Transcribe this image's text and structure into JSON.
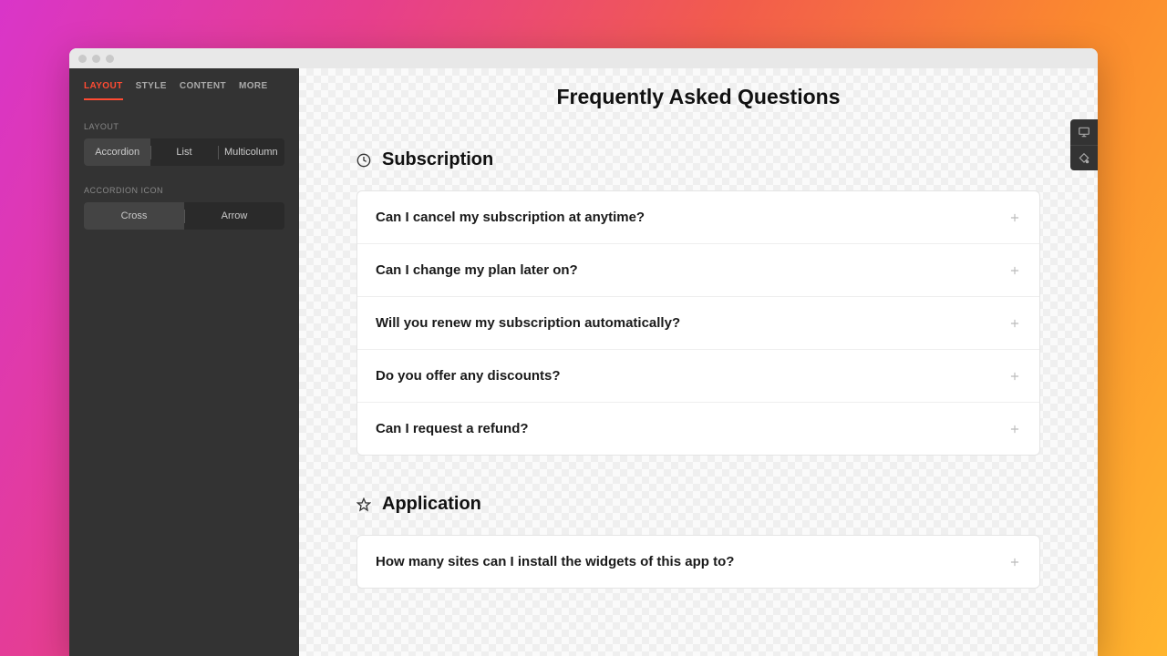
{
  "sidebar": {
    "tabs": [
      {
        "label": "LAYOUT",
        "active": true
      },
      {
        "label": "STYLE",
        "active": false
      },
      {
        "label": "CONTENT",
        "active": false
      },
      {
        "label": "MORE",
        "active": false
      }
    ],
    "layout_section_label": "LAYOUT",
    "layout_options": [
      {
        "label": "Accordion",
        "active": true
      },
      {
        "label": "List",
        "active": false
      },
      {
        "label": "Multicolumn",
        "active": false
      }
    ],
    "icon_section_label": "ACCORDION ICON",
    "icon_options": [
      {
        "label": "Cross",
        "active": true
      },
      {
        "label": "Arrow",
        "active": false
      }
    ]
  },
  "main": {
    "title": "Frequently Asked Questions",
    "categories": [
      {
        "icon": "clock",
        "title": "Subscription",
        "items": [
          {
            "q": "Can I cancel my subscription at anytime?"
          },
          {
            "q": "Can I change my plan later on?"
          },
          {
            "q": "Will you renew my subscription automatically?"
          },
          {
            "q": "Do you offer any discounts?"
          },
          {
            "q": "Can I request a refund?"
          }
        ]
      },
      {
        "icon": "star",
        "title": "Application",
        "items": [
          {
            "q": "How many sites can I install the widgets of this app to?"
          }
        ]
      }
    ]
  }
}
